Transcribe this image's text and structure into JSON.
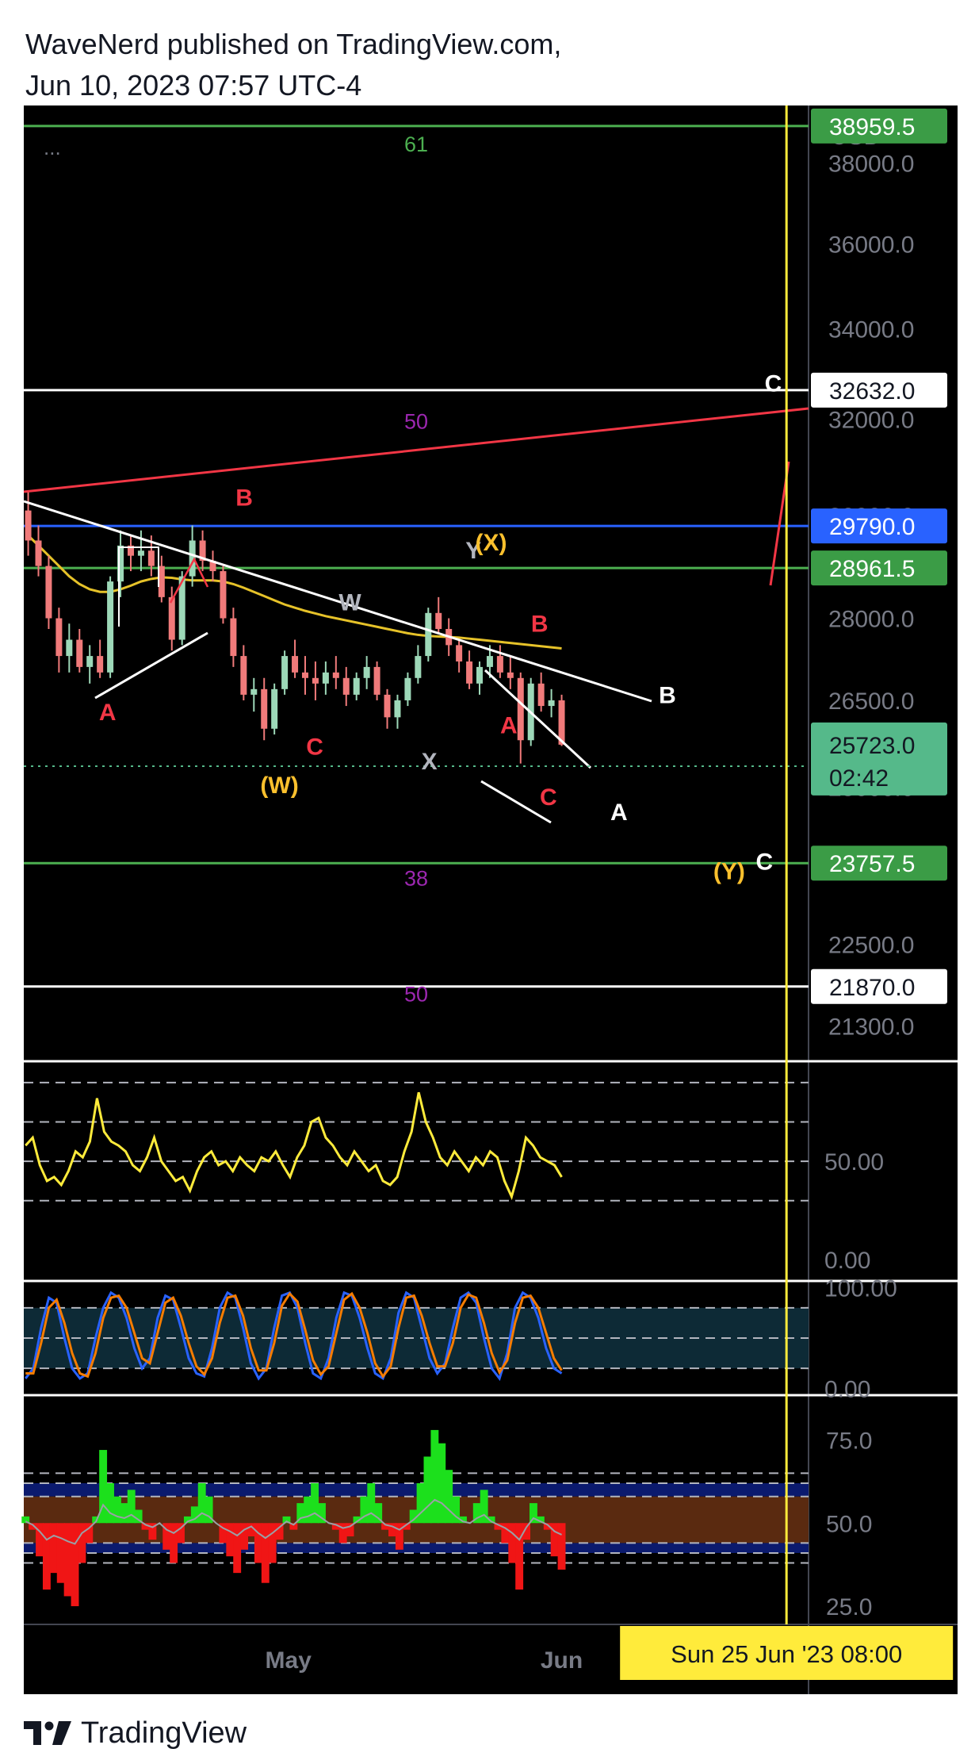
{
  "header": {
    "line1": "WaveNerd published on TradingView.com,",
    "line2": "Jun 10, 2023 07:57 UTC-4"
  },
  "footer": {
    "brand": "TradingView",
    "logo_icon": "tradingview-logo-icon"
  },
  "chart_data": [
    {
      "type": "candlestick",
      "currency": "USD",
      "menu_dots": "...",
      "ylim": [
        20800,
        39500
      ],
      "log_scale": true,
      "y_ticks": [
        "38000.0",
        "36000.0",
        "34000.0",
        "32000.0",
        "30000.0",
        "28000.0",
        "26500.0",
        "25000.0",
        "22500.0",
        "21300.0"
      ],
      "x_ticks": [
        {
          "label": "May",
          "day": 30
        },
        {
          "label": "Jun",
          "day": 61
        }
      ],
      "x_range_days": [
        0,
        89
      ],
      "crosshair": {
        "day": 86.5,
        "label": "Sun 25 Jun '23   08:00"
      },
      "price_badges": [
        {
          "value": "38959.5",
          "price": 38959.5,
          "bg": "#3b9c46",
          "fg": "#ffffff",
          "line": "#4caf50"
        },
        {
          "value": "32632.0",
          "price": 32632.0,
          "bg": "#ffffff",
          "fg": "#131722",
          "line": "#ffffff"
        },
        {
          "value": "29790.0",
          "price": 29790.0,
          "bg": "#2962ff",
          "fg": "#ffffff",
          "line": "#2962ff"
        },
        {
          "value": "28961.5",
          "price": 28961.5,
          "bg": "#3b9c46",
          "fg": "#ffffff",
          "line": "#4caf50"
        },
        {
          "value": "23757.5",
          "price": 23757.5,
          "bg": "#3b9c46",
          "fg": "#ffffff",
          "line": "#4caf50"
        },
        {
          "value": "21870.0",
          "price": 21870.0,
          "bg": "#ffffff",
          "fg": "#131722",
          "line": "#ffffff"
        }
      ],
      "last_price": {
        "value": "25723.0",
        "countdown": "02:42",
        "price": 25723.0,
        "bg": "#55b98a"
      },
      "fib_labels": [
        {
          "text": "61",
          "price": 38300,
          "color": "#4caf50"
        },
        {
          "text": "50",
          "price": 31800,
          "color": "#9c27b0"
        },
        {
          "text": "38",
          "price": 23400,
          "color": "#9c27b0"
        },
        {
          "text": "50",
          "price": 21650,
          "color": "#9c27b0"
        }
      ],
      "ohlc": [
        [
          30100,
          30500,
          29200,
          29500
        ],
        [
          29500,
          29800,
          28800,
          29000
        ],
        [
          29000,
          29200,
          27800,
          28000
        ],
        [
          28000,
          28200,
          27000,
          27300
        ],
        [
          27300,
          27900,
          27000,
          27600
        ],
        [
          27600,
          27800,
          27000,
          27100
        ],
        [
          27100,
          27500,
          26800,
          27300
        ],
        [
          27300,
          27600,
          26900,
          27000
        ],
        [
          27000,
          28800,
          26900,
          28700
        ],
        [
          28700,
          29700,
          28400,
          29400
        ],
        [
          29400,
          29600,
          28900,
          29200
        ],
        [
          29200,
          29700,
          28900,
          29300
        ],
        [
          29300,
          29600,
          28800,
          29000
        ],
        [
          29000,
          29200,
          28300,
          28400
        ],
        [
          28400,
          28600,
          27400,
          27600
        ],
        [
          27600,
          28900,
          27500,
          28800
        ],
        [
          28800,
          29800,
          28600,
          29500
        ],
        [
          29500,
          29700,
          28900,
          29100
        ],
        [
          29100,
          29300,
          28700,
          28900
        ],
        [
          28900,
          29000,
          27900,
          28000
        ],
        [
          28000,
          28200,
          27100,
          27300
        ],
        [
          27300,
          27500,
          26500,
          26600
        ],
        [
          26600,
          26900,
          26300,
          26700
        ],
        [
          26700,
          26900,
          25800,
          26000
        ],
        [
          26000,
          26800,
          25900,
          26700
        ],
        [
          26700,
          27400,
          26600,
          27300
        ],
        [
          27300,
          27600,
          26900,
          27000
        ],
        [
          27000,
          27300,
          26600,
          26900
        ],
        [
          26900,
          27200,
          26500,
          26800
        ],
        [
          26800,
          27200,
          26600,
          27000
        ],
        [
          27000,
          27300,
          26700,
          26900
        ],
        [
          26900,
          27100,
          26400,
          26600
        ],
        [
          26600,
          27000,
          26500,
          26900
        ],
        [
          26900,
          27300,
          26700,
          27100
        ],
        [
          27100,
          27200,
          26500,
          26600
        ],
        [
          26600,
          26700,
          26000,
          26200
        ],
        [
          26200,
          26600,
          26000,
          26500
        ],
        [
          26500,
          27000,
          26400,
          26900
        ],
        [
          26900,
          27500,
          26800,
          27300
        ],
        [
          27300,
          28200,
          27200,
          28100
        ],
        [
          28100,
          28400,
          27700,
          27800
        ],
        [
          27800,
          28000,
          27300,
          27500
        ],
        [
          27500,
          27600,
          27000,
          27200
        ],
        [
          27200,
          27400,
          26700,
          26800
        ],
        [
          26800,
          27200,
          26600,
          27100
        ],
        [
          27100,
          27500,
          26900,
          27300
        ],
        [
          27300,
          27500,
          26900,
          27000
        ],
        [
          27000,
          27300,
          26700,
          26900
        ],
        [
          26900,
          27000,
          25400,
          25800
        ],
        [
          25800,
          26900,
          25700,
          26800
        ],
        [
          26800,
          27000,
          26300,
          26400
        ],
        [
          26400,
          26700,
          26200,
          26500
        ],
        [
          26500,
          26600,
          25700,
          25723
        ]
      ],
      "sma": [
        29600,
        29400,
        29200,
        29000,
        28800,
        28650,
        28550,
        28500,
        28500,
        28550,
        28620,
        28700,
        28750,
        28780,
        28770,
        28740,
        28720,
        28720,
        28720,
        28700,
        28650,
        28580,
        28500,
        28420,
        28340,
        28260,
        28200,
        28140,
        28090,
        28040,
        28000,
        27960,
        27920,
        27880,
        27840,
        27800,
        27760,
        27720,
        27690,
        27670,
        27660,
        27650,
        27640,
        27620,
        27600,
        27580,
        27560,
        27540,
        27520,
        27500,
        27480,
        27460,
        27440
      ],
      "annotations": [
        {
          "text": "A",
          "day": 9.5,
          "price": 26150,
          "color": "#f23645"
        },
        {
          "text": "B",
          "day": 25,
          "price": 30200,
          "color": "#f23645"
        },
        {
          "text": "W",
          "day": 37,
          "price": 28150,
          "color": "#b2b5be"
        },
        {
          "text": "C",
          "day": 33,
          "price": 25550,
          "color": "#f23645"
        },
        {
          "text": "(W)",
          "day": 29,
          "price": 24900,
          "color": "#fbc02d"
        },
        {
          "text": "Y",
          "day": 51,
          "price": 29150,
          "color": "#b2b5be"
        },
        {
          "text": "(X)",
          "day": 53,
          "price": 29300,
          "color": "#fbc02d"
        },
        {
          "text": "X",
          "day": 46,
          "price": 25300,
          "color": "#b2b5be"
        },
        {
          "text": "A",
          "day": 55,
          "price": 25920,
          "color": "#f23645"
        },
        {
          "text": "B",
          "day": 58.5,
          "price": 27750,
          "color": "#f23645"
        },
        {
          "text": "C",
          "day": 59.5,
          "price": 24700,
          "color": "#f23645"
        },
        {
          "text": "A",
          "day": 67.5,
          "price": 24450,
          "color": "#ffffff"
        },
        {
          "text": "B",
          "day": 73,
          "price": 26450,
          "color": "#ffffff"
        },
        {
          "text": "(Y)",
          "day": 80,
          "price": 23500,
          "color": "#fbc02d"
        },
        {
          "text": "C",
          "day": 84,
          "price": 23650,
          "color": "#ffffff"
        },
        {
          "text": "C",
          "day": 85,
          "price": 32600,
          "color": "#ffffff"
        }
      ]
    },
    {
      "type": "line",
      "name": "rsi",
      "y_ticks": [
        "50.00",
        "0.00"
      ],
      "ylim": [
        -10,
        100
      ],
      "levels": [
        90,
        70,
        50,
        30
      ],
      "series": [
        {
          "color": "#ffeb3b",
          "values": [
            58,
            62,
            48,
            40,
            42,
            38,
            45,
            55,
            52,
            60,
            82,
            65,
            60,
            58,
            55,
            48,
            45,
            52,
            62,
            50,
            45,
            40,
            42,
            35,
            45,
            52,
            55,
            48,
            50,
            45,
            52,
            48,
            45,
            52,
            50,
            55,
            48,
            42,
            52,
            58,
            70,
            72,
            62,
            58,
            52,
            48,
            55,
            50,
            45,
            48,
            40,
            38,
            42,
            55,
            65,
            85,
            70,
            62,
            52,
            48,
            55,
            50,
            45,
            52,
            48,
            55,
            52,
            40,
            32,
            45,
            62,
            58,
            52,
            50,
            48,
            42
          ]
        }
      ]
    },
    {
      "type": "line",
      "name": "stoch-rsi",
      "y_ticks": [
        "100.00",
        "0.00"
      ],
      "ylim": [
        -5,
        105
      ],
      "levels": [
        80,
        50,
        20
      ],
      "series": [
        {
          "color": "#2962ff",
          "values": [
            10,
            20,
            60,
            90,
            85,
            50,
            20,
            10,
            15,
            50,
            80,
            95,
            90,
            70,
            40,
            20,
            30,
            70,
            92,
            88,
            60,
            30,
            15,
            12,
            40,
            80,
            95,
            90,
            60,
            25,
            10,
            20,
            60,
            92,
            95,
            80,
            45,
            15,
            10,
            30,
            70,
            95,
            92,
            70,
            40,
            15,
            10,
            30,
            75,
            95,
            90,
            60,
            30,
            15,
            25,
            60,
            90,
            95,
            85,
            50,
            20,
            10,
            35,
            80,
            95,
            90,
            70,
            40,
            20,
            15
          ]
        },
        {
          "color": "#f57c00",
          "values": [
            15,
            15,
            45,
            80,
            88,
            65,
            35,
            15,
            12,
            35,
            70,
            90,
            92,
            80,
            55,
            30,
            25,
            55,
            85,
            90,
            72,
            45,
            22,
            14,
            30,
            65,
            90,
            92,
            72,
            40,
            18,
            18,
            45,
            82,
            94,
            86,
            58,
            28,
            14,
            22,
            55,
            88,
            94,
            80,
            55,
            25,
            12,
            22,
            60,
            90,
            92,
            72,
            45,
            22,
            22,
            45,
            80,
            93,
            90,
            65,
            35,
            16,
            28,
            65,
            90,
            92,
            80,
            55,
            30,
            18
          ]
        }
      ]
    },
    {
      "type": "area",
      "name": "momentum-histogram",
      "y_ticks": [
        "75.0",
        "50.0",
        "25.0"
      ],
      "ylim": [
        20,
        88
      ],
      "levels": [
        65,
        62,
        58,
        44,
        41,
        38
      ],
      "baseline": 50,
      "values": [
        52,
        48,
        40,
        30,
        35,
        32,
        28,
        25,
        38,
        44,
        52,
        72,
        62,
        58,
        56,
        60,
        54,
        48,
        45,
        50,
        42,
        38,
        44,
        52,
        55,
        62,
        58,
        50,
        44,
        40,
        35,
        42,
        46,
        38,
        32,
        38,
        45,
        52,
        48,
        56,
        58,
        62,
        56,
        50,
        48,
        44,
        46,
        52,
        58,
        62,
        56,
        48,
        46,
        42,
        48,
        54,
        62,
        70,
        78,
        74,
        66,
        58,
        52,
        50,
        56,
        60,
        52,
        48,
        44,
        38,
        30,
        45,
        56,
        52,
        48,
        40,
        36
      ]
    }
  ]
}
